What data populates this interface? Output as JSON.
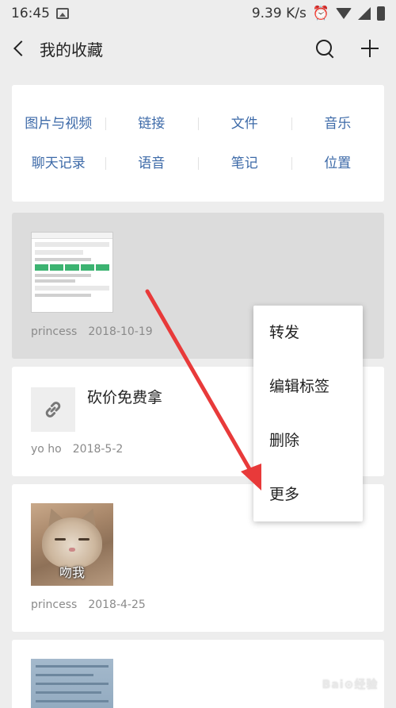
{
  "status_bar": {
    "time": "16:45",
    "network_speed": "9.39 K/s"
  },
  "nav": {
    "title": "我的收藏"
  },
  "categories": [
    [
      "图片与视频",
      "链接",
      "文件",
      "音乐"
    ],
    [
      "聊天记录",
      "语音",
      "笔记",
      "位置"
    ]
  ],
  "favorites": [
    {
      "type": "image",
      "author": "princess",
      "date": "2018-10-19",
      "selected": true
    },
    {
      "type": "link",
      "title": "砍价免费拿",
      "author": "yo ho",
      "date": "2018-5-2"
    },
    {
      "type": "image",
      "caption": "吻我",
      "author": "princess",
      "date": "2018-4-25"
    },
    {
      "type": "image"
    }
  ],
  "context_menu": {
    "items": [
      "转发",
      "编辑标签",
      "删除",
      "更多"
    ]
  },
  "colors": {
    "category_text": "#3d6aa8",
    "arrow": "#e83a3a",
    "background": "#ededed"
  }
}
